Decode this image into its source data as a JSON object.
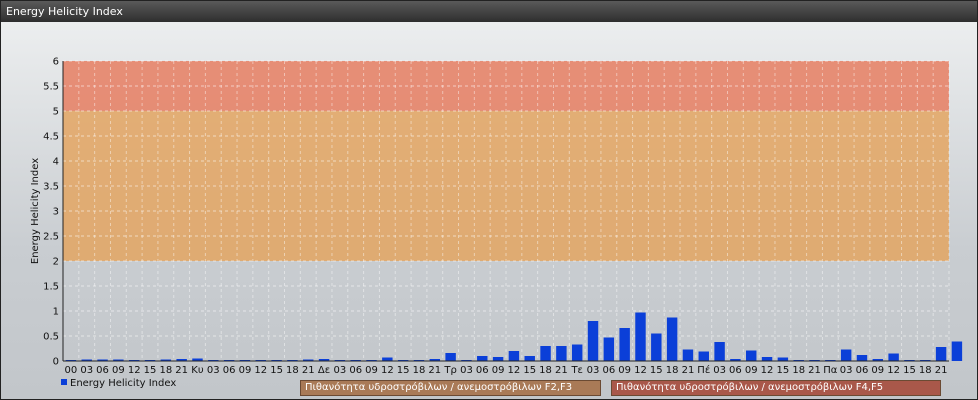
{
  "window": {
    "title": "Energy Helicity Index"
  },
  "chart_data": {
    "type": "bar",
    "ylabel": "Energy Helicity Index",
    "ylim": [
      0,
      6
    ],
    "yticks": [
      "0",
      "0.5",
      "1",
      "1.5",
      "2",
      "2.5",
      "3",
      "3.5",
      "4",
      "4.5",
      "5",
      "5.5",
      "6"
    ],
    "grid": true,
    "categories": [
      "00",
      "03",
      "06",
      "09",
      "12",
      "15",
      "18",
      "21",
      "Κυ",
      "03",
      "06",
      "09",
      "12",
      "15",
      "18",
      "21",
      "Δε",
      "03",
      "06",
      "09",
      "12",
      "15",
      "18",
      "21",
      "Τρ",
      "03",
      "06",
      "09",
      "12",
      "15",
      "18",
      "21",
      "Τε",
      "03",
      "06",
      "09",
      "12",
      "15",
      "18",
      "21",
      "Πέ",
      "03",
      "06",
      "09",
      "12",
      "15",
      "18",
      "21",
      "Πα",
      "03",
      "06",
      "09",
      "12",
      "15",
      "18",
      "21"
    ],
    "series": [
      {
        "name": "Energy Helicity Index",
        "color": "#0b3fd8",
        "values": [
          0.02,
          0.03,
          0.03,
          0.03,
          0.02,
          0.02,
          0.03,
          0.04,
          0.05,
          0.02,
          0.02,
          0.02,
          0.02,
          0.02,
          0.02,
          0.03,
          0.04,
          0.02,
          0.02,
          0.02,
          0.07,
          0.02,
          0.02,
          0.04,
          0.16,
          0.02,
          0.1,
          0.08,
          0.2,
          0.1,
          0.3,
          0.3,
          0.33,
          0.8,
          0.47,
          0.66,
          0.97,
          0.55,
          0.87,
          0.23,
          0.19,
          0.38,
          0.04,
          0.21,
          0.08,
          0.07,
          0.02,
          0.02,
          0.02,
          0.23,
          0.12,
          0.04,
          0.15,
          0.02,
          0.02,
          0.28,
          0.39
        ]
      }
    ],
    "bands": [
      {
        "from": 2,
        "to": 5,
        "color": "#e3a562",
        "label": "Πιθανότητα υδροστρόβιλων / ανεμοστρόβιλων F2,F3"
      },
      {
        "from": 5,
        "to": 6,
        "color": "#e67e62",
        "label": "Πιθανότητα υδροστρόβιλων / ανεμοστρόβιλων F4,F5"
      }
    ],
    "legend": {
      "position": "bottom-left",
      "label": "Energy Helicity Index"
    }
  }
}
